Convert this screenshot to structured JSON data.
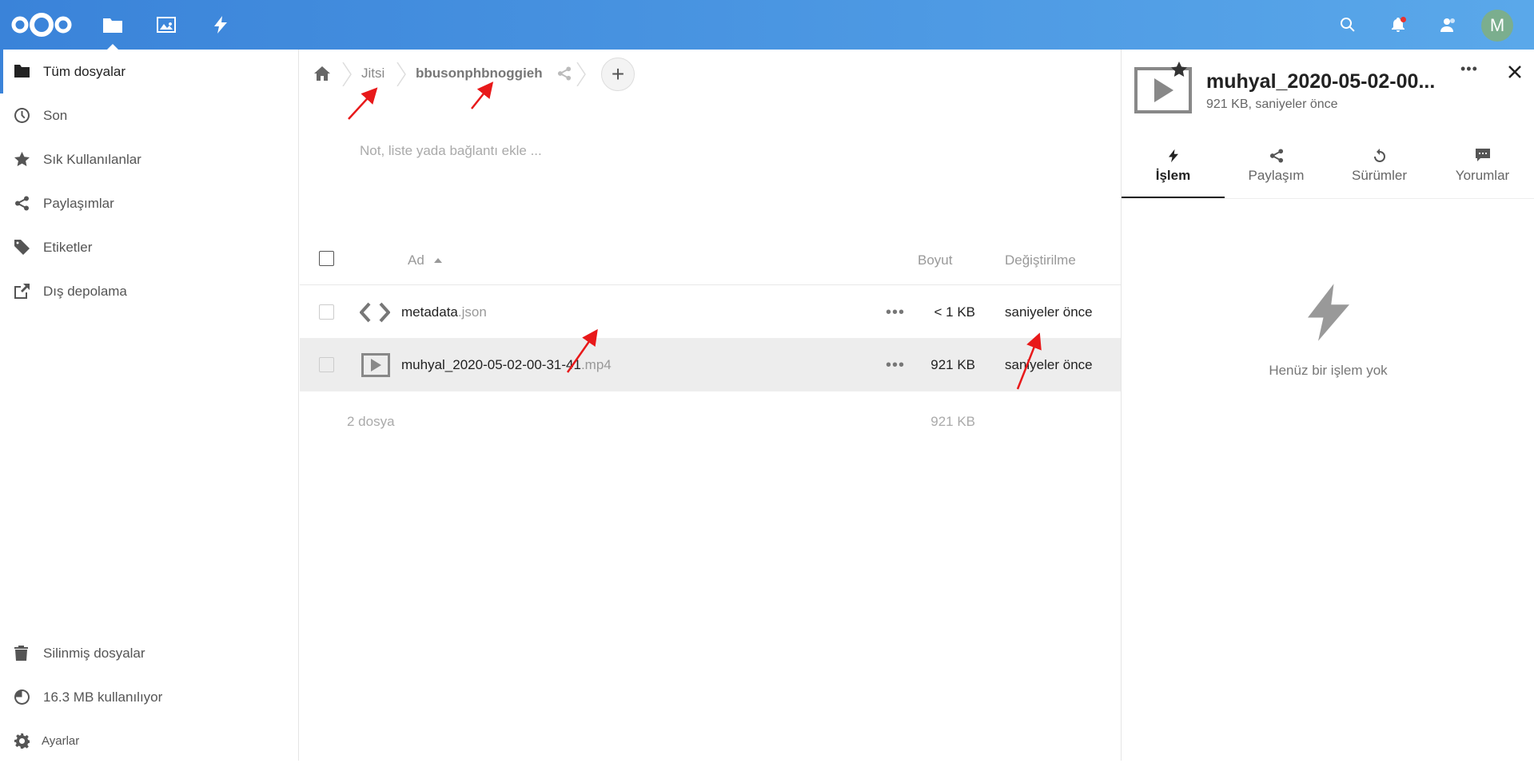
{
  "header": {
    "avatar_initial": "M",
    "accent": "#3a83d9"
  },
  "sidebar": {
    "items": [
      {
        "label": "Tüm dosyalar",
        "icon": "folder-icon"
      },
      {
        "label": "Son",
        "icon": "clock-icon"
      },
      {
        "label": "Sık Kullanılanlar",
        "icon": "star-icon"
      },
      {
        "label": "Paylaşımlar",
        "icon": "share-icon"
      },
      {
        "label": "Etiketler",
        "icon": "tag-icon"
      },
      {
        "label": "Dış depolama",
        "icon": "external-icon"
      }
    ],
    "bottom": [
      {
        "label": "Silinmiş dosyalar",
        "icon": "trash-icon"
      },
      {
        "label": "16.3 MB kullanılıyor",
        "icon": "pie-icon"
      },
      {
        "label": "Ayarlar",
        "icon": "gear-icon"
      }
    ]
  },
  "breadcrumb": {
    "items": [
      "Jitsi",
      "bbusonphbnoggieh"
    ]
  },
  "note": {
    "placeholder": "Not, liste yada bağlantı ekle ..."
  },
  "table": {
    "columns": {
      "name": "Ad",
      "size": "Boyut",
      "modified": "Değiştirilme"
    },
    "rows": [
      {
        "name": "metadata",
        "ext": ".json",
        "size": "< 1 KB",
        "modified": "saniyeler önce"
      },
      {
        "name": "muhyal_2020-05-02-00-31-41",
        "ext": ".mp4",
        "size": "921 KB",
        "modified": "saniyeler önce"
      }
    ],
    "summary": {
      "count": "2 dosya",
      "size": "921 KB"
    },
    "dots": "•••"
  },
  "panel": {
    "title": "muhyal_2020-05-02-00...",
    "subtitle": "921 KB, saniyeler önce",
    "tabs": [
      "İşlem",
      "Paylaşım",
      "Sürümler",
      "Yorumlar"
    ],
    "empty_text": "Henüz bir işlem yok"
  }
}
